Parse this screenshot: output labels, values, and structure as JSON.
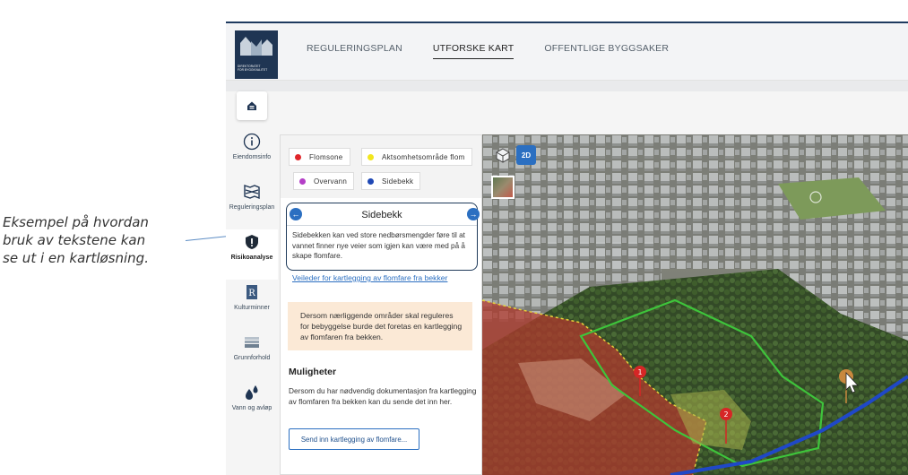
{
  "annotation": {
    "line1": "Eksempel på hvordan",
    "line2": "bruk av tekstene kan",
    "line3": "se ut i en kartløsning."
  },
  "header": {
    "logo_text_line1": "DIREKTORATET",
    "logo_text_line2": "FOR BYGGKVALITET",
    "nav": [
      "REGULERINGSPLAN",
      "UTFORSKE KART",
      "OFFENTLIGE BYGGSAKER"
    ],
    "active_nav": "UTFORSKE KART"
  },
  "sidebar": {
    "items": [
      {
        "label": "Eiendomsinfo",
        "icon": "info-icon"
      },
      {
        "label": "Reguleringsplan",
        "icon": "map-layers-icon"
      },
      {
        "label": "Risikoanalyse",
        "icon": "warning-shield-icon",
        "active": true
      },
      {
        "label": "Kulturminner",
        "icon": "culture-r-icon"
      },
      {
        "label": "Grunnforhold",
        "icon": "ground-icon"
      },
      {
        "label": "Vann og avløp",
        "icon": "water-drops-icon"
      }
    ]
  },
  "legend": {
    "items": [
      {
        "label": "Flomsone",
        "color": "#e0262b"
      },
      {
        "label": "Aktsomhetsområde flom",
        "color": "#f2e61e"
      },
      {
        "label": "Overvann",
        "color": "#b43fc7"
      },
      {
        "label": "Sidebekk",
        "color": "#1f48b5"
      }
    ]
  },
  "card": {
    "title": "Sidebekk",
    "body": "Sidebekken kan ved store nedbørsmengder føre til at vannet finner nye veier som igjen kan være med på å skape flomfare."
  },
  "guide_link": "Veileder for kartlegging av flomfare fra bekker",
  "note": "Dersom nærliggende områder skal reguleres for bebyggelse burde det foretas en kartlegging av flomfaren fra bekken.",
  "muligheter": {
    "title": "Muligheter",
    "body": "Dersom du har nødvendig dokumentasjon fra kartlegging av flomfaren fra bekken kan du sende det inn her.",
    "button": "Send inn kartlegging av flomfare..."
  },
  "map": {
    "view_2d_label": "2D",
    "markers": [
      "1",
      "2"
    ]
  },
  "colors": {
    "brand": "#1f3553",
    "accent": "#2b6fc1",
    "note_bg": "#fbe9d6"
  }
}
